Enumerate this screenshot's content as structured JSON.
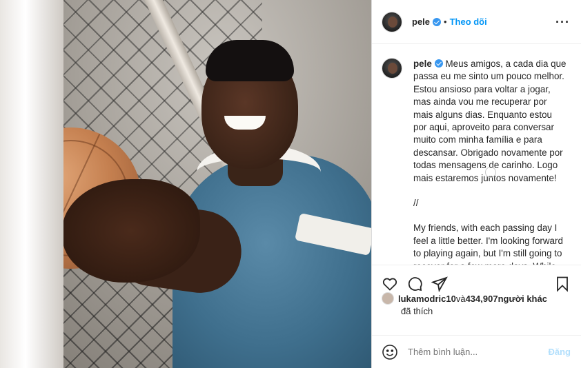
{
  "post": {
    "username": "pele",
    "separator": "•",
    "follow_label": "Theo dõi",
    "more_icon": "more-horizontal-icon",
    "caption_pt": "Meus amigos, a cada dia que passa eu me sinto um pouco melhor. Estou ansioso para voltar a jogar, mas ainda vou me recuperar por mais alguns dias. Enquanto estou por aqui, aproveito para conversar muito com minha família e para descansar. Obrigado novamente por todas mensagens de carinho. Logo mais estaremos juntos novamente!",
    "divider": "//",
    "caption_en": "My friends, with each passing day I feel a little better. I'm looking forward to playing again, but I'm still going to recover for a few more days. While I'm here, I take the opportunity to talk a lot with my family and to rest. Thanks"
  },
  "likes": {
    "liker": "lukamodric10",
    "and_text": " và ",
    "count": "434,907",
    "others": " người khác",
    "suffix": "đã thích"
  },
  "comment": {
    "placeholder": "Thêm bình luận...",
    "post_label": "Đăng"
  },
  "colors": {
    "accent": "#0095f6",
    "verified": "#3897f0",
    "post_disabled": "#b2dffc"
  }
}
